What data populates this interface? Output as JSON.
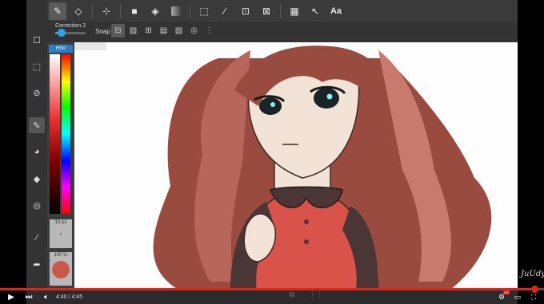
{
  "toolbar": {
    "icons": [
      "brush-icon",
      "eraser-icon",
      "move-icon",
      "fill-rect-icon",
      "bucket-icon",
      "gradient-icon",
      "select-icon",
      "magic-wand-icon",
      "edit-select-icon",
      "transform-icon",
      "layout-icon",
      "pointer-icon"
    ],
    "text_tool": "Aa"
  },
  "subbar": {
    "correction_label": "Correction 2",
    "correction_value": 0.2,
    "snap_label": "Snap",
    "more": "⋮"
  },
  "colorpanel": {
    "mode_label": "HSV",
    "brush_size": "13 px",
    "opacity": "100 %",
    "current_color": "#c8584a"
  },
  "player": {
    "time": "4:40 / 4:45",
    "progress": 0.982
  },
  "watermark": "JuUdy",
  "colors": {
    "accent_blue": "#2aa7e8",
    "progress_red": "#e62117",
    "hair": "#9a4b3f",
    "dress": "#d9534a"
  }
}
